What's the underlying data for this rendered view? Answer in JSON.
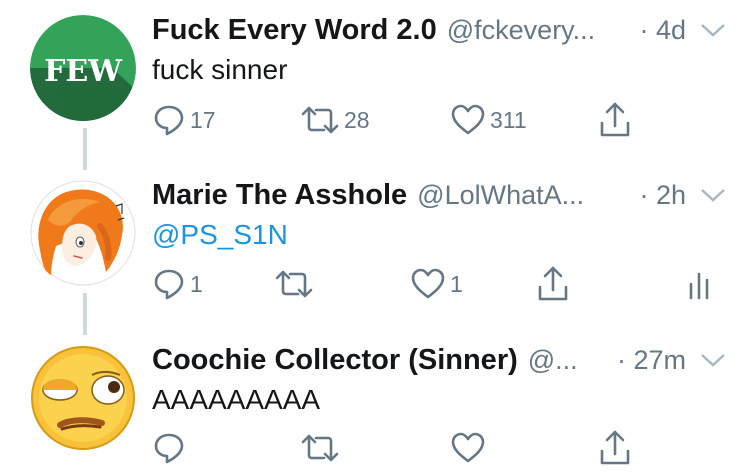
{
  "tweets": [
    {
      "avatar_text": "FEW",
      "name": "Fuck Every Word 2.0",
      "handle": "@fckevery...",
      "time": "· 4d",
      "text": "fuck sinner",
      "text_style": "plain",
      "replies": "17",
      "retweets": "28",
      "likes": "311"
    },
    {
      "name": "Marie The Asshole",
      "handle": "@LolWhatA...",
      "time": "· 2h",
      "text": "@PS_S1N",
      "text_style": "mention",
      "replies": "1",
      "retweets": "",
      "likes": "1",
      "analytics": true
    },
    {
      "name": "Coochie Collector (Sinner)",
      "handle": "@...",
      "time": "· 27m",
      "text": "AAAAAAAAA",
      "text_style": "plain",
      "replies": "",
      "retweets": "",
      "likes": ""
    }
  ],
  "icons": {
    "reply": "reply-icon",
    "retweet": "retweet-icon",
    "like": "heart-icon",
    "share": "share-icon",
    "analytics": "analytics-icon",
    "caret": "chevron-down-icon"
  },
  "colors": {
    "text": "#14171a",
    "secondary": "#657786",
    "link": "#1b95e0",
    "thread_line": "#cfd9de",
    "few_green": "#2d7a4a"
  }
}
